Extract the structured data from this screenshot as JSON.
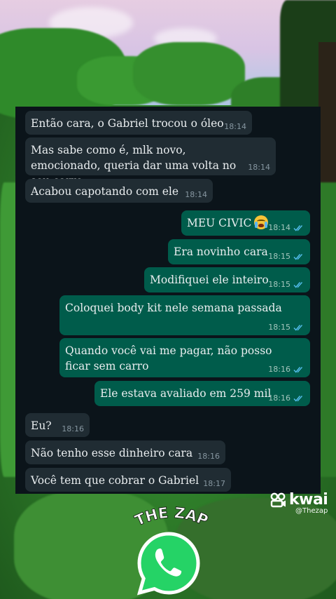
{
  "messages": [
    {
      "dir": "in",
      "text": "Então cara, o Gabriel trocou o óleo",
      "time": "18:14"
    },
    {
      "dir": "in",
      "text": "Mas sabe como é, mlk novo, emocionado, queria dar uma volta no seu carro",
      "time": "18:14"
    },
    {
      "dir": "in",
      "text": "Acabou capotando com ele",
      "time": "18:14"
    },
    {
      "dir": "out",
      "text": "MEU CIVIC",
      "emoji": "loudly-crying-face-emoji",
      "time": "18:14"
    },
    {
      "dir": "out",
      "text": "Era novinho cara",
      "time": "18:15"
    },
    {
      "dir": "out",
      "text": "Modifiquei ele inteiro",
      "time": "18:15"
    },
    {
      "dir": "out",
      "text": "Coloquei body kit nele semana passada",
      "time": "18:15"
    },
    {
      "dir": "out",
      "text": "Quando você vai me pagar, não posso ficar sem carro",
      "time": "18:16"
    },
    {
      "dir": "out",
      "text": "Ele estava avaliado em 259 mil",
      "time": "18:16"
    },
    {
      "dir": "in",
      "text": "Eu?",
      "time": "18:16"
    },
    {
      "dir": "in",
      "text": "Não tenho esse dinheiro cara",
      "time": "18:16"
    },
    {
      "dir": "in",
      "text": "Você tem que cobrar o Gabriel",
      "time": "18:17"
    }
  ],
  "watermark": {
    "brand": "kwai",
    "handle": "@Thezap",
    "icon": "kwai-logo-icon"
  },
  "logo": {
    "text": "THE ZAP",
    "icon": "whatsapp-icon"
  },
  "colors": {
    "chat_bg": "#0b141a",
    "incoming_bubble": "#202c33",
    "outgoing_bubble": "#005c4b",
    "read_ticks": "#53bdeb",
    "logo_green": "#25d366"
  }
}
